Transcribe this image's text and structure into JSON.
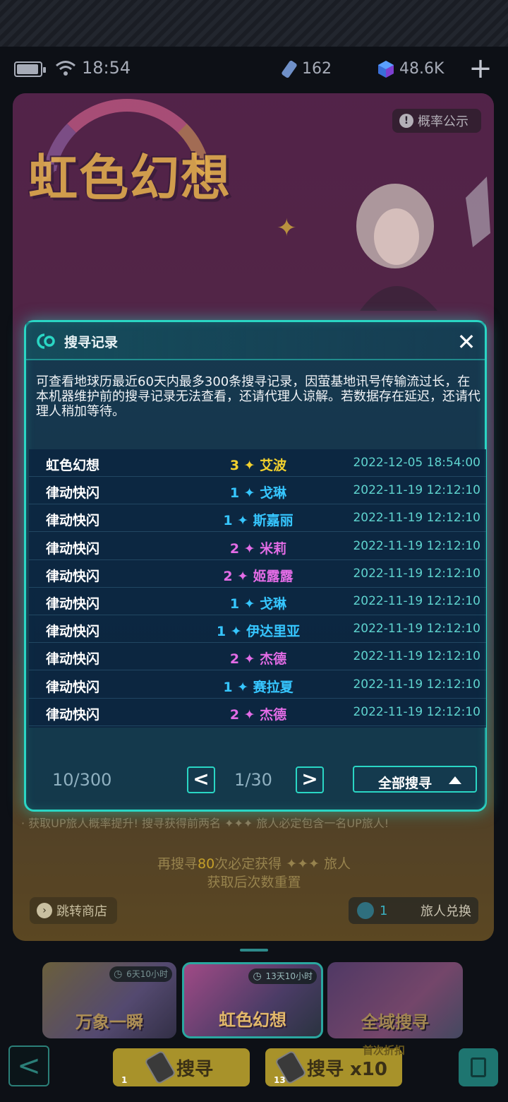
{
  "status_bar": {
    "time": "18:54",
    "currency_1": "162",
    "currency_2": "48.6K",
    "plus": "+"
  },
  "banner": {
    "title": "虹色幻想",
    "probability_button": "概率公示",
    "probability_icon": "!",
    "info_line": "· 获取UP旅人概率提升! 搜寻获得前两名 ✦✦✦ 旅人必定包含一名UP旅人!",
    "pity_line_1_prefix": "再搜寻",
    "pity_count": "80",
    "pity_line_1_suffix": "次必定获得 ✦✦✦ 旅人",
    "pity_line_2": "获取后次数重置",
    "shop_button": "跳转商店",
    "exchange_count": "1",
    "exchange_button": "旅人兑换"
  },
  "pool_tabs": [
    {
      "label": "万象一瞬",
      "timer": "6天10小时"
    },
    {
      "label": "虹色幻想",
      "timer": "13天10小时"
    },
    {
      "label": "全域搜寻",
      "timer": ""
    }
  ],
  "action_bar": {
    "back": "<",
    "search_1_label": "搜寻",
    "search_1_count": "1",
    "search_10_label": "搜寻 x10",
    "search_10_count": "13",
    "discount_tag": "首次折扣"
  },
  "modal": {
    "title": "搜寻记录",
    "close": "✕",
    "description": "可查看地球历最近60天内最多300条搜寻记录，因萤基地讯号传输流过长，在本机器维护前的搜寻记录无法查看，还请代理人谅解。若数据存在延迟，还请代理人稍加等待。",
    "records": [
      {
        "pool": "虹色幻想",
        "rank": "3 ✦ 艾波",
        "rarity": "r3",
        "time": "2022-12-05 18:54:00"
      },
      {
        "pool": "律动快闪",
        "rank": "1 ✦ 戈琳",
        "rarity": "r1",
        "time": "2022-11-19 12:12:10"
      },
      {
        "pool": "律动快闪",
        "rank": "1 ✦ 斯嘉丽",
        "rarity": "r1",
        "time": "2022-11-19 12:12:10"
      },
      {
        "pool": "律动快闪",
        "rank": "2 ✦ 米莉",
        "rarity": "r2",
        "time": "2022-11-19 12:12:10"
      },
      {
        "pool": "律动快闪",
        "rank": "2 ✦ 姬露露",
        "rarity": "r2",
        "time": "2022-11-19 12:12:10"
      },
      {
        "pool": "律动快闪",
        "rank": "1 ✦ 戈琳",
        "rarity": "r1",
        "time": "2022-11-19 12:12:10"
      },
      {
        "pool": "律动快闪",
        "rank": "1 ✦ 伊达里亚",
        "rarity": "r1",
        "time": "2022-11-19 12:12:10"
      },
      {
        "pool": "律动快闪",
        "rank": "2 ✦ 杰德",
        "rarity": "r2",
        "time": "2022-11-19 12:12:10"
      },
      {
        "pool": "律动快闪",
        "rank": "1 ✦ 赛拉夏",
        "rarity": "r1",
        "time": "2022-11-19 12:12:10"
      },
      {
        "pool": "律动快闪",
        "rank": "2 ✦ 杰德",
        "rarity": "r2",
        "time": "2022-11-19 12:12:10"
      }
    ],
    "record_count": "10/300",
    "page_prev": "<",
    "page_indicator": "1/30",
    "page_next": ">",
    "filter_button": "全部搜寻"
  }
}
